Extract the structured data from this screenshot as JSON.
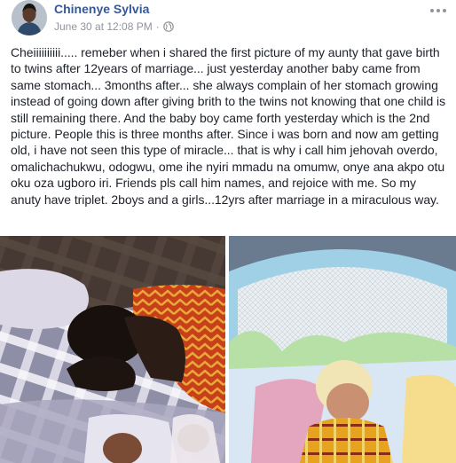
{
  "post": {
    "author": "Chinenye Sylvia",
    "timestamp": "June 30 at 12:08 PM",
    "separator": "·",
    "privacy_icon": "globe-icon",
    "more_icon": "more-horizontal-icon",
    "text": "Cheiiiiiiiiii..... remeber when i shared the first picture of my aunty that gave birth to twins after 12years of marriage... just yesterday another baby came from same stomach... 3months after... she always complain of her stomach growing instead of going down after giving brith to the twins not knowing that one child is still remaining there. And the baby boy came forth yesterday which is the 2nd picture. People this is three months after. Since i was born and now am getting old, i have not seen this type of miracle... that is why i call him jehovah overdo, omalichachukwu, odogwu, ome ihe nyiri mmadu na omumw, onye ana akpo otu oku oza ugboro iri. Friends pls call him names, and rejoice with me. So my anuty have triplet. 2boys and a girls...12yrs after marriage in a miraculous way."
  },
  "colors": {
    "author_link": "#365899",
    "meta_gray": "#90949c",
    "body_text": "#1d2129"
  },
  "photos": [
    {
      "id": "photo-mother-with-twins"
    },
    {
      "id": "photo-baby-in-net"
    }
  ]
}
